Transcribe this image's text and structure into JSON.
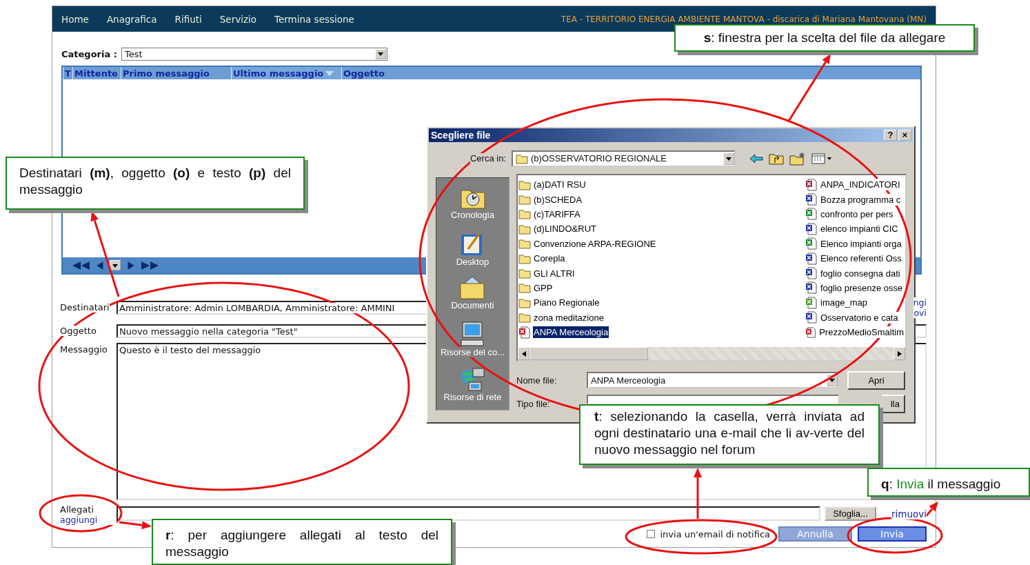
{
  "nav": {
    "items": [
      "Home",
      "Anagrafica",
      "Rifiuti",
      "Servizio",
      "Termina sessione"
    ],
    "site_title": "TEA - TERRITORIO ENERGIA AMBIENTE MANTOVA - discarica di Mariana Mantovana (MN)"
  },
  "category": {
    "label": "Categoria :",
    "value": "Test"
  },
  "table": {
    "columns": [
      {
        "label": "T",
        "sorted": false
      },
      {
        "label": "Mittente",
        "sorted": false
      },
      {
        "label": "Primo messaggio",
        "sorted": false
      },
      {
        "label": "Ultimo messaggio",
        "sorted": true
      },
      {
        "label": "Oggetto",
        "sorted": false
      }
    ]
  },
  "form": {
    "recipients": {
      "label": "Destinatari",
      "value": "Amministratore: Admin LOMBARDIA, Amministratore: AMMINI"
    },
    "recipient_links": [
      "ngi",
      "ovi"
    ],
    "subject": {
      "label": "Oggetto",
      "value": "Nuovo messaggio nella categoria \"Test\""
    },
    "message": {
      "label": "Messaggio",
      "value": "Questo è il testo del messaggio"
    },
    "attachments": {
      "label": "Allegati",
      "add_link": "aggiungi",
      "browse_button": "Sfoglia...",
      "remove_link": "rimuovi"
    },
    "notify": {
      "label": "invia un'email di notifica",
      "checked": false
    },
    "buttons": [
      "Annulla",
      "Invia"
    ]
  },
  "dialog": {
    "title": "Scegliere file",
    "title_buttons": [
      "?",
      "×"
    ],
    "look_in_label": "Cerca in:",
    "look_in_value": "(b)OSSERVATORIO REGIONALE",
    "places": [
      {
        "label": "Cronologia",
        "kind": "history"
      },
      {
        "label": "Desktop",
        "kind": "desktop"
      },
      {
        "label": "Documenti",
        "kind": "documents"
      },
      {
        "label": "Risorse del co...",
        "kind": "computer"
      },
      {
        "label": "Risorse di rete",
        "kind": "network"
      }
    ],
    "files": [
      {
        "name": "(a)DATI RSU",
        "kind": "folder",
        "selected": false
      },
      {
        "name": "(b)SCHEDA",
        "kind": "folder",
        "selected": false
      },
      {
        "name": "(c)TARIFFA",
        "kind": "folder",
        "selected": false
      },
      {
        "name": "(d)LINDO&RUT",
        "kind": "folder",
        "selected": false
      },
      {
        "name": "Convenzione ARPA-REGIONE",
        "kind": "folder",
        "selected": false
      },
      {
        "name": "Corepla",
        "kind": "folder",
        "selected": false
      },
      {
        "name": "GLI ALTRI",
        "kind": "folder",
        "selected": false
      },
      {
        "name": "GPP",
        "kind": "folder",
        "selected": false
      },
      {
        "name": "Piano Regionale",
        "kind": "folder",
        "selected": false
      },
      {
        "name": "zona meditazione",
        "kind": "folder",
        "selected": false
      },
      {
        "name": "ANPA Merceologia",
        "kind": "pdf",
        "selected": true
      },
      {
        "name": "ANPA_INDICATORI",
        "kind": "ppt",
        "selected": false
      },
      {
        "name": "Bozza programma c",
        "kind": "word",
        "selected": false
      },
      {
        "name": "confronto per pers",
        "kind": "excel",
        "selected": false
      },
      {
        "name": "elenco impianti CIC",
        "kind": "word",
        "selected": false
      },
      {
        "name": "Elenco impianti orga",
        "kind": "excel",
        "selected": false
      },
      {
        "name": "Elenco referenti Oss",
        "kind": "word",
        "selected": false
      },
      {
        "name": "foglio consegna dati",
        "kind": "word",
        "selected": false
      },
      {
        "name": "foglio presenze osse",
        "kind": "word",
        "selected": false
      },
      {
        "name": "image_map",
        "kind": "image",
        "selected": false
      },
      {
        "name": "Osservatorio e cata",
        "kind": "word",
        "selected": false
      },
      {
        "name": "PrezzoMedioSmaltim",
        "kind": "pdf",
        "selected": false
      }
    ],
    "file_name_label": "Nome file:",
    "file_name_value": "ANPA Merceologia",
    "open_button": "Apri",
    "file_type_label": "Tipo file:",
    "cancel_button": "lla"
  },
  "callouts": [
    {
      "text": "**s**: finestra per la scelta del file da allegare"
    },
    {
      "text": "Destinatari **(m)**, oggetto **(o)** e testo **(p)** del messaggio"
    },
    {
      "text": "**t**: selezionando la casella, verrà inviata ad ogni destinatario una e-mail che li av-verte del nuovo messaggio nel forum"
    },
    {
      "text": "**q**:",
      "highlight": "Invia",
      "tail": "il messaggio"
    },
    {
      "text": "**r**: per aggiungere allegati al testo del messaggio"
    }
  ]
}
